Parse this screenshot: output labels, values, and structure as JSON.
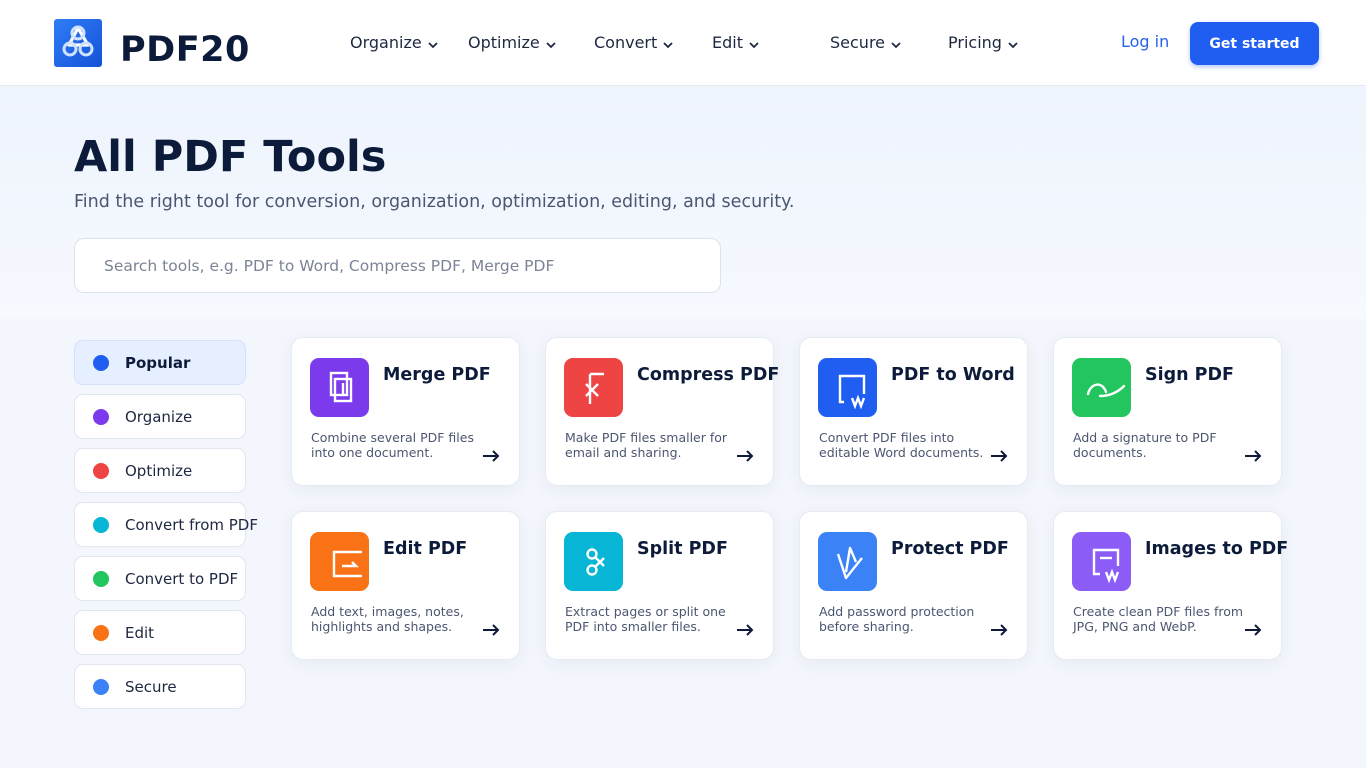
{
  "header": {
    "logo_text": "PDF20",
    "nav": [
      {
        "label": "Organize"
      },
      {
        "label": "Optimize"
      },
      {
        "label": "Convert"
      },
      {
        "label": "Edit"
      },
      {
        "label": "Secure"
      },
      {
        "label": "Pricing"
      }
    ],
    "login_label": "Log in",
    "cta_label": "Get started"
  },
  "hero": {
    "title": "All PDF Tools",
    "subtitle": "Find the right tool for conversion, organization, optimization, editing, and security.",
    "search_placeholder": "Search tools, e.g. PDF to Word, Compress PDF, Merge PDF"
  },
  "categories": [
    {
      "label": "Popular",
      "color": "#1f5ef0",
      "active": true
    },
    {
      "label": "Organize",
      "color": "#7c3aed"
    },
    {
      "label": "Optimize",
      "color": "#ef4444"
    },
    {
      "label": "Convert from PDF",
      "color": "#06b6d4"
    },
    {
      "label": "Convert to PDF",
      "color": "#22c55e"
    },
    {
      "label": "Edit",
      "color": "#f97316"
    },
    {
      "label": "Secure",
      "color": "#3b82f6"
    }
  ],
  "tools": [
    {
      "title": "Merge PDF",
      "desc": "Combine several PDF files into one document.",
      "color": "#7c3aed",
      "icon": "merge-icon"
    },
    {
      "title": "Compress PDF",
      "desc": "Make PDF files smaller for email and sharing.",
      "color": "#ef4444",
      "icon": "compress-icon"
    },
    {
      "title": "PDF to Word",
      "desc": "Convert PDF files into editable Word documents.",
      "color": "#1f5ef0",
      "icon": "word-icon"
    },
    {
      "title": "Sign PDF",
      "desc": "Add a signature to PDF documents.",
      "color": "#22c55e",
      "icon": "signature-icon"
    },
    {
      "title": "Edit PDF",
      "desc": "Add text, images, notes, highlights and shapes.",
      "color": "#f97316",
      "icon": "edit-icon"
    },
    {
      "title": "Split PDF",
      "desc": "Extract pages or split one PDF into smaller files.",
      "color": "#06b6d4",
      "icon": "split-icon"
    },
    {
      "title": "Protect PDF",
      "desc": "Add password protection before sharing.",
      "color": "#3b82f6",
      "icon": "shield-icon"
    },
    {
      "title": "Images to PDF",
      "desc": "Create clean PDF files from JPG, PNG and WebP.",
      "color": "#8b5cf6",
      "icon": "image-icon"
    }
  ]
}
